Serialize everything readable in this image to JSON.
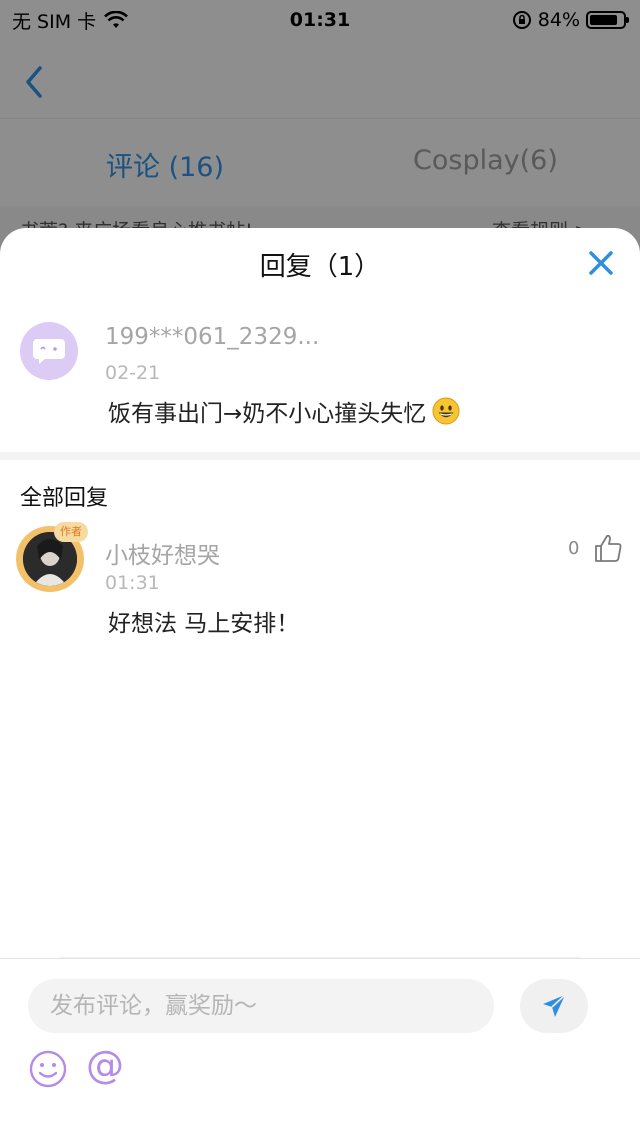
{
  "status_bar": {
    "carrier": "无 SIM 卡",
    "time": "01:31",
    "battery": "84%",
    "battery_level": 0.84
  },
  "background": {
    "tabs": [
      {
        "label": "评论 (16)",
        "active": true
      },
      {
        "label": "Cosplay(6)",
        "active": false
      }
    ],
    "notice_text": "书荒? 来广场看良心推书帖!",
    "notice_link": "查看规则 >"
  },
  "sheet": {
    "title": "回复（1）",
    "main_comment": {
      "username": "199***061_2329...",
      "date": "02-21",
      "text": "饭有事出门→奶不小心撞头失忆",
      "emoji": "grinning-face-emoji"
    },
    "all_replies_title": "全部回复",
    "replies": [
      {
        "username": "小枝好想哭",
        "time": "01:31",
        "text": "好想法 马上安排！",
        "likes": "0",
        "badge": "作者"
      }
    ]
  },
  "input": {
    "placeholder": "发布评论，赢奖励～",
    "at_symbol": "@"
  },
  "colors": {
    "accent_blue": "#2f8ee0",
    "avatar_purple": "#dccbf5",
    "icon_purple": "#b58be6"
  }
}
